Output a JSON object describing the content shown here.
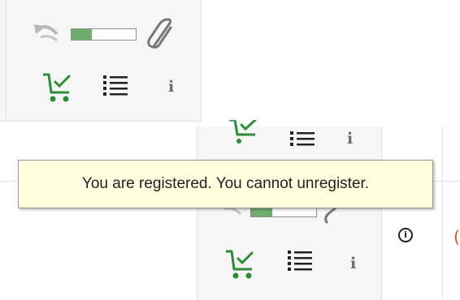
{
  "top_toolbar": {
    "progress_fraction": 0.32,
    "icons": [
      "undo-icon",
      "progress-bar",
      "paperclip-icon",
      "cart-check-icon",
      "list-icon",
      "info-icon"
    ]
  },
  "bottom_toolbar": {
    "progress_fraction": 0.32,
    "icons": [
      "cart-check-icon",
      "list-icon",
      "info-icon",
      "info-circle-icon"
    ]
  },
  "tooltip": {
    "text": "You are registered. You cannot unregister."
  },
  "info_letter": "i",
  "circle_letter": "i",
  "colors": {
    "progress_fill": "#6fae6f",
    "cart_green": "#2e8b3a",
    "tooltip_bg": "#ffffe0"
  }
}
